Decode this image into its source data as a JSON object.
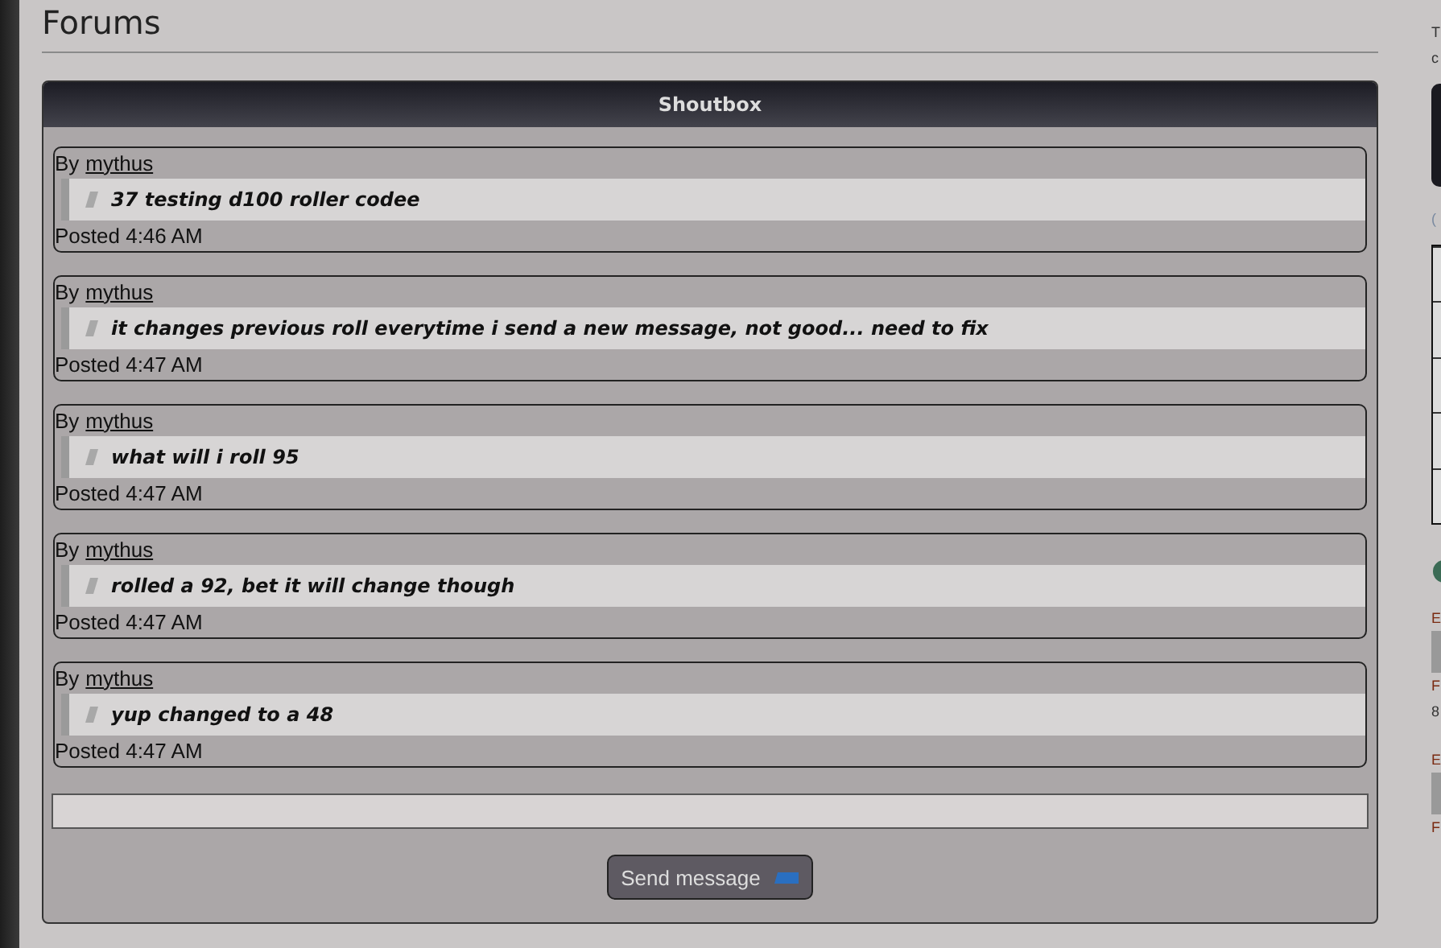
{
  "page_title": "Forums",
  "shoutbox": {
    "title": "Shoutbox",
    "messages": [
      {
        "by": "By",
        "author": "mythus",
        "text": "37 testing d100 roller codee",
        "posted": "Posted 4:46 AM"
      },
      {
        "by": "By",
        "author": "mythus",
        "text": "it changes previous roll everytime i send a new message, not good... need to fix",
        "posted": "Posted 4:47 AM"
      },
      {
        "by": "By",
        "author": "mythus",
        "text": "what will i roll 95",
        "posted": "Posted 4:47 AM"
      },
      {
        "by": "By",
        "author": "mythus",
        "text": "rolled a 92, bet it will change though",
        "posted": "Posted 4:47 AM"
      },
      {
        "by": "By",
        "author": "mythus",
        "text": "yup changed to a 48",
        "posted": "Posted 4:47 AM"
      }
    ],
    "send_button": "Send message"
  },
  "sidebar_fragments": {
    "top": [
      "T",
      "c"
    ],
    "paren": "(",
    "entries": [
      {
        "first": "E",
        "second": "F",
        "third": "8"
      },
      {
        "first": "E",
        "second": "F"
      }
    ]
  }
}
